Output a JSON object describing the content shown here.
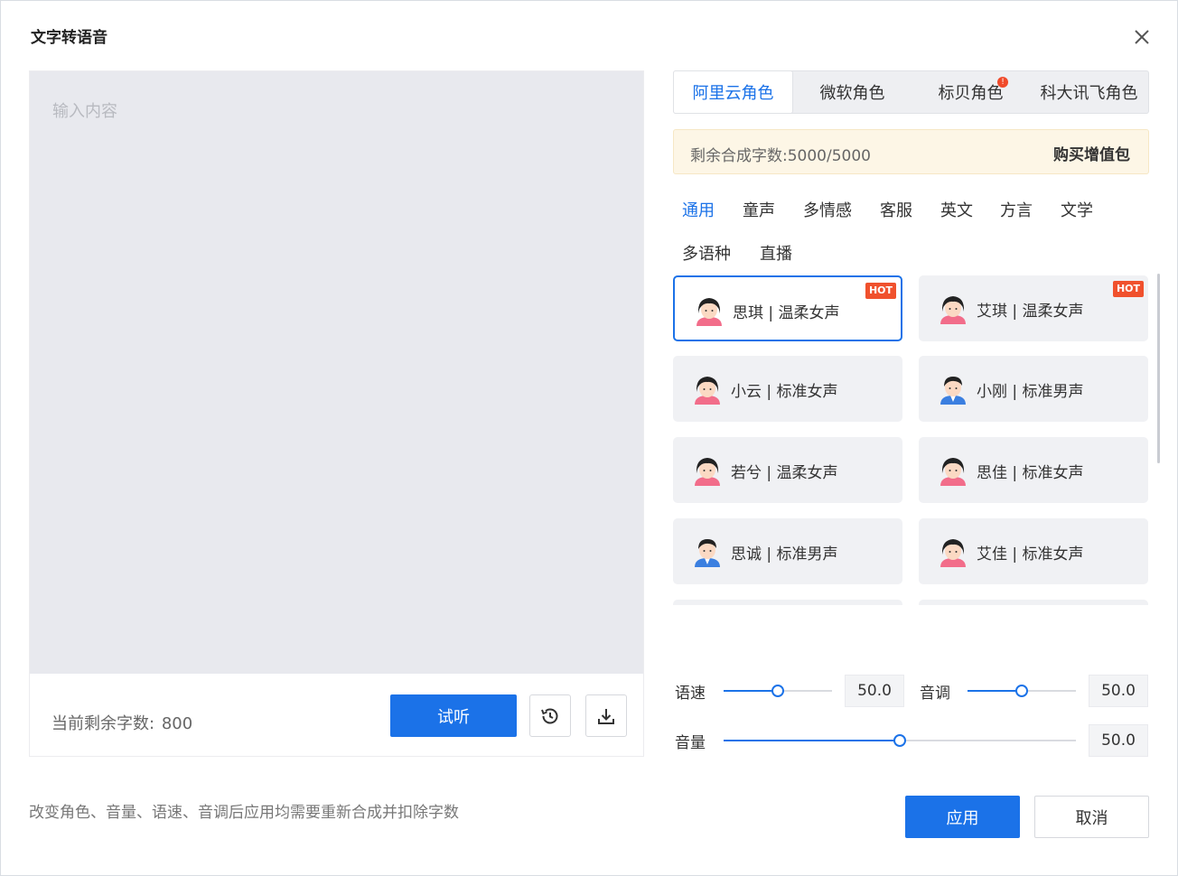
{
  "dialog": {
    "title": "文字转语音"
  },
  "editor": {
    "placeholder": "输入内容",
    "value": "",
    "remaining_label": "当前剩余字数:",
    "remaining_count": "800",
    "listen_label": "试听",
    "history_icon": "history-icon",
    "download_icon": "download-icon"
  },
  "role_tabs": [
    {
      "label": "阿里云角色",
      "active": true
    },
    {
      "label": "微软角色",
      "active": false
    },
    {
      "label": "标贝角色",
      "active": false,
      "badge": "!"
    },
    {
      "label": "科大讯飞角色",
      "active": false
    }
  ],
  "quota": {
    "text": "剩余合成字数:5000/5000",
    "buy_label": "购买增值包"
  },
  "categories": [
    {
      "label": "通用",
      "active": true
    },
    {
      "label": "童声",
      "active": false
    },
    {
      "label": "多情感",
      "active": false
    },
    {
      "label": "客服",
      "active": false
    },
    {
      "label": "英文",
      "active": false
    },
    {
      "label": "方言",
      "active": false
    },
    {
      "label": "文学",
      "active": false
    },
    {
      "label": "多语种",
      "active": false
    },
    {
      "label": "直播",
      "active": false
    }
  ],
  "voices": [
    {
      "name": "思琪 | 温柔女声",
      "gender": "female",
      "hot": "HOT",
      "selected": true
    },
    {
      "name": "艾琪 | 温柔女声",
      "gender": "female",
      "hot": "HOT",
      "selected": false
    },
    {
      "name": "小云 | 标准女声",
      "gender": "female",
      "hot": "",
      "selected": false
    },
    {
      "name": "小刚 | 标准男声",
      "gender": "male",
      "hot": "",
      "selected": false
    },
    {
      "name": "若兮 | 温柔女声",
      "gender": "female",
      "hot": "",
      "selected": false
    },
    {
      "name": "思佳 | 标准女声",
      "gender": "female",
      "hot": "",
      "selected": false
    },
    {
      "name": "思诚 | 标准男声",
      "gender": "male",
      "hot": "",
      "selected": false
    },
    {
      "name": "艾佳 | 标准女声",
      "gender": "female",
      "hot": "",
      "selected": false
    }
  ],
  "controls": {
    "speed": {
      "label": "语速",
      "value": "50.0",
      "level": 0.5
    },
    "pitch": {
      "label": "音调",
      "value": "50.0",
      "level": 0.5
    },
    "volume": {
      "label": "音量",
      "value": "50.0",
      "level": 0.5
    }
  },
  "footer": {
    "note": "改变角色、音量、语速、音调后应用均需要重新合成并扣除字数",
    "apply_label": "应用",
    "cancel_label": "取消"
  },
  "colors": {
    "primary": "#1b72e8",
    "hot": "#f0512d",
    "quota_bg": "#fdf6e6"
  }
}
